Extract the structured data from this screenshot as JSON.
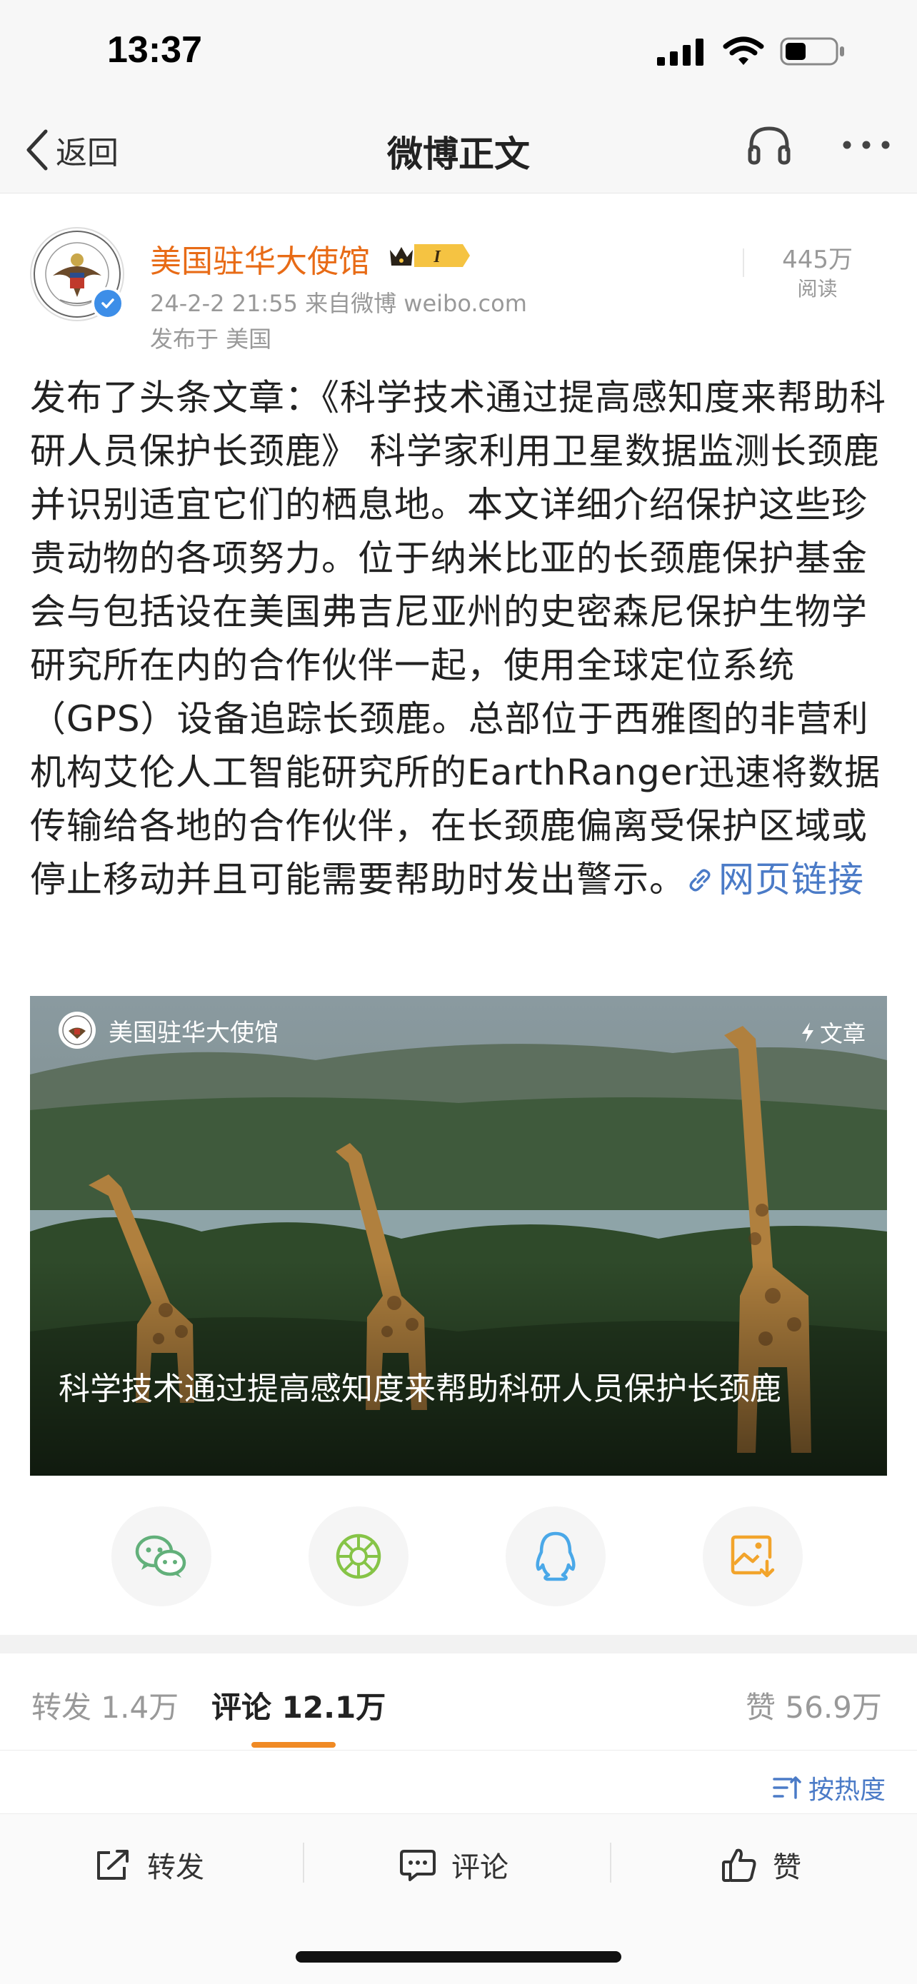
{
  "status_bar": {
    "time": "13:37"
  },
  "nav": {
    "back_label": "返回",
    "title": "微博正文"
  },
  "post": {
    "author": "美国驻华大使馆",
    "badge": "I",
    "read_count": "445万",
    "read_unit": "阅读",
    "meta": "24-2-2 21:55  来自微博 weibo.com",
    "location": "发布于 美国",
    "body": "发布了头条文章：《科学技术通过提高感知度来帮助科研人员保护长颈鹿》 科学家利用卫星数据监测长颈鹿并识别适宜它们的栖息地。本文详细介绍保护这些珍贵动物的各项努力。位于纳米比亚的长颈鹿保护基金会与包括设在美国弗吉尼亚州的史密森尼保护生物学研究所在内的合作伙伴一起，使用全球定位系统（GPS）设备追踪长颈鹿。总部位于西雅图的非营利机构艾伦人工智能研究所的EarthRanger迅速将数据传输给各地的合作伙伴，在长颈鹿偏离受保护区域或停止移动并且可能需要帮助时发出警示。",
    "link_label": "网页链接"
  },
  "article_card": {
    "source": "美国驻华大使馆",
    "type_label": "文章",
    "title": "科学技术通过提高感知度来帮助科研人员保护长颈鹿"
  },
  "share_icons": [
    "wechat-icon",
    "moments-icon",
    "qq-icon",
    "save-image-icon"
  ],
  "tabs": {
    "repost": {
      "label": "转发",
      "count": "1.4万"
    },
    "comment": {
      "label": "评论",
      "count": "12.1万"
    },
    "like": {
      "label": "赞",
      "count": "56.9万"
    }
  },
  "sort_label": "按热度",
  "toolbar": {
    "repost": "转发",
    "comment": "评论",
    "like": "赞"
  },
  "colors": {
    "accent": "#f08a24",
    "author": "#e86b16",
    "link": "#4b7bc7"
  }
}
